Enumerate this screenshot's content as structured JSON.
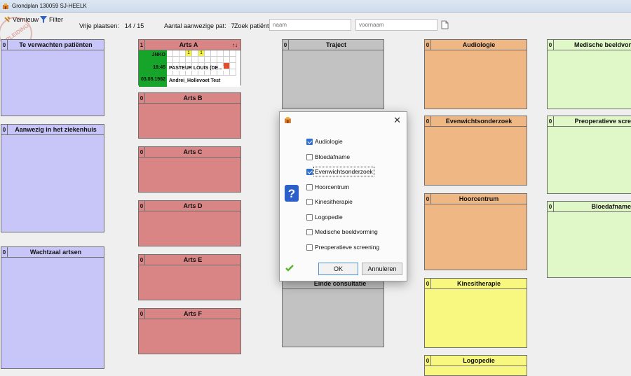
{
  "window": {
    "title": "Grondplan 130059 SJ-HEELK"
  },
  "toolbar": {
    "refresh_label": "Vernieuw",
    "filter_label": "Filter",
    "free_places_label": "Vrije plaatsen:",
    "free_places_value": "14 / 15",
    "present_label": "Aantal aanwezige pat:",
    "present_value": "7",
    "search_label": "Zoek patiënt",
    "name_placeholder": "naam",
    "firstname_placeholder": "voornaam"
  },
  "stamp_text": "OPLEIDING",
  "panels": {
    "te_verwachten": {
      "count": "0",
      "title": "Te verwachten patiënten"
    },
    "aanwezig": {
      "count": "0",
      "title": "Aanwezig in het ziekenhuis"
    },
    "wachtzaal": {
      "count": "0",
      "title": "Wachtzaal artsen"
    },
    "arts_a": {
      "count": "1",
      "title": "Arts A",
      "sort_icon": "↑↓"
    },
    "arts_b": {
      "count": "0",
      "title": "Arts B"
    },
    "arts_c": {
      "count": "0",
      "title": "Arts C"
    },
    "arts_d": {
      "count": "0",
      "title": "Arts D"
    },
    "arts_e": {
      "count": "0",
      "title": "Arts E"
    },
    "arts_f": {
      "count": "0",
      "title": "Arts F"
    },
    "traject": {
      "count": "0",
      "title": "Traject"
    },
    "einde": {
      "title": "Einde consultatie"
    },
    "audiologie": {
      "count": "0",
      "title": "Audiologie"
    },
    "evenwicht": {
      "count": "0",
      "title": "Evenwichtsonderzoek"
    },
    "hoorcentrum": {
      "count": "0",
      "title": "Hoorcentrum"
    },
    "kinesitherapie": {
      "count": "0",
      "title": "Kinesitherapie"
    },
    "logopedie": {
      "count": "0",
      "title": "Logopedie"
    },
    "medische": {
      "count": "0",
      "title": "Medische beeldvor"
    },
    "preoperatieve": {
      "count": "0",
      "title": "Preoperatieve scre"
    },
    "bloedafname": {
      "count": "0",
      "title": "Bloedafname"
    }
  },
  "patient_card": {
    "code": "JNKO",
    "time": "18:45",
    "dob": "03.08.1982",
    "name": "PASTEUR LOUIS (DE...",
    "sub": "Andrei_Hollevoet Test",
    "slot1": "1",
    "slot2": "1"
  },
  "dialog": {
    "close_glyph": "✕",
    "options": [
      {
        "label": "Audiologie",
        "checked": true
      },
      {
        "label": "Bloedafname",
        "checked": false
      },
      {
        "label": "Evenwichtsonderzoek",
        "checked": true
      },
      {
        "label": "Hoorcentrum",
        "checked": false
      },
      {
        "label": "Kinesitherapie",
        "checked": false
      },
      {
        "label": "Logopedie",
        "checked": false
      },
      {
        "label": "Medische beeldvorming",
        "checked": false
      },
      {
        "label": "Preoperatieve screening",
        "checked": false
      }
    ],
    "ok_label": "OK",
    "cancel_label": "Annuleren"
  },
  "colors": {
    "blue": "#c8c6f8",
    "red": "#d98585",
    "grey": "#c2c2c2",
    "orange": "#eeb784",
    "green": "#e0f8c8",
    "yellow": "#f8f880",
    "patient_green": "#16a52a"
  }
}
